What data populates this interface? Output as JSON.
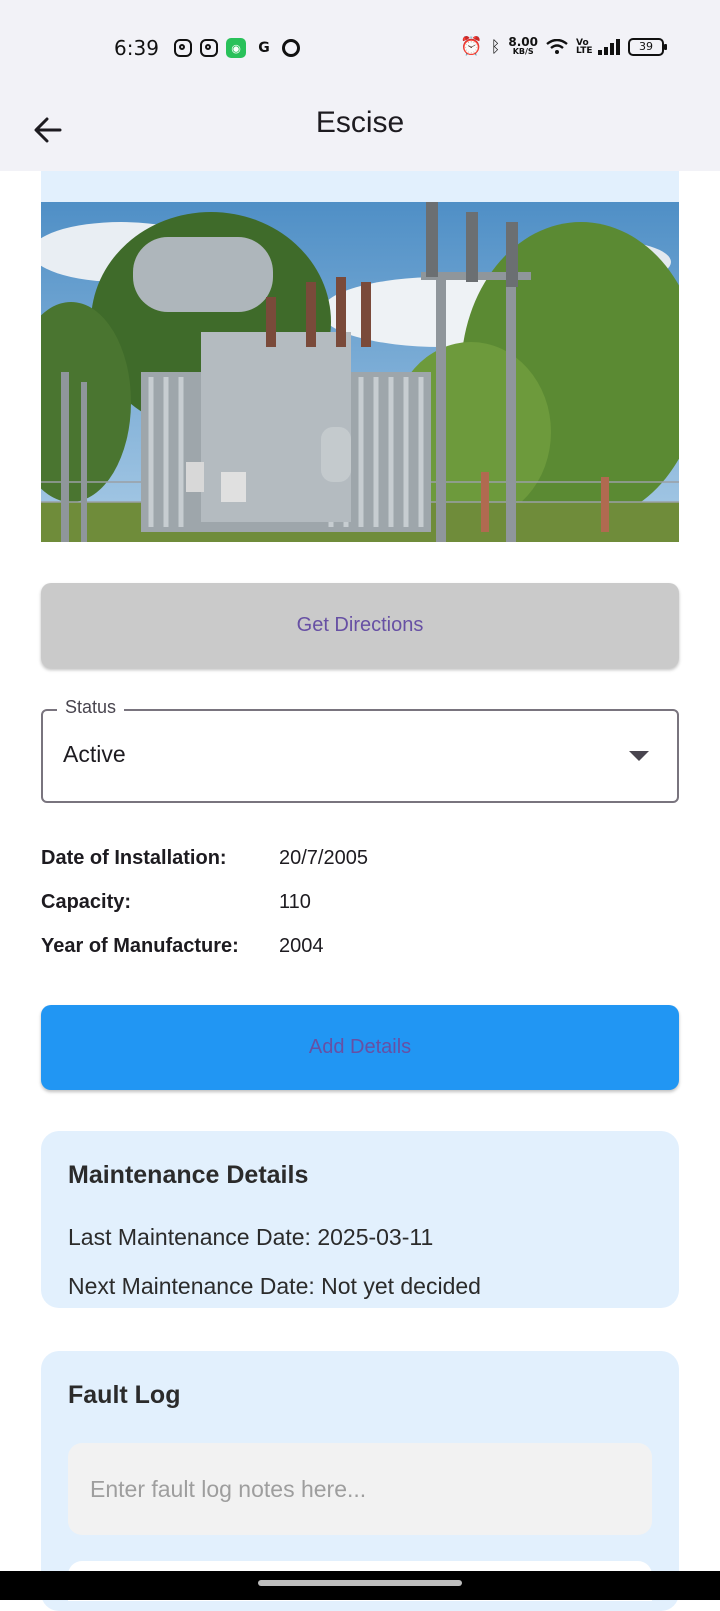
{
  "status_bar": {
    "time": "6:39",
    "left_icons": [
      "instagram-icon",
      "instagram-icon",
      "app-icon",
      "google-icon",
      "chrome-icon"
    ],
    "net_speed": "8.00",
    "net_speed_unit": "KB/S",
    "volte": "Vo LTE",
    "battery": "39"
  },
  "app_bar": {
    "title": "Escise"
  },
  "directions_button": {
    "label": "Get Directions"
  },
  "status": {
    "label": "Status",
    "value": "Active"
  },
  "details": [
    {
      "label": "Date of Installation:",
      "value": "20/7/2005"
    },
    {
      "label": "Capacity:",
      "value": "110"
    },
    {
      "label": "Year of Manufacture:",
      "value": "2004"
    }
  ],
  "add_details_button": {
    "label": "Add Details"
  },
  "maintenance": {
    "title": "Maintenance Details",
    "last": "Last Maintenance Date: 2025-03-11",
    "next": "Next Maintenance Date: Not yet decided"
  },
  "fault_log": {
    "title": "Fault Log",
    "placeholder": "Enter fault log notes here...",
    "value": ""
  },
  "colors": {
    "header_bg": "#f2f2f7",
    "card_bg": "#e2f0fd",
    "primary_button": "#2196f3",
    "disabled_button": "#cacaca",
    "button_text": "#6750a4"
  }
}
